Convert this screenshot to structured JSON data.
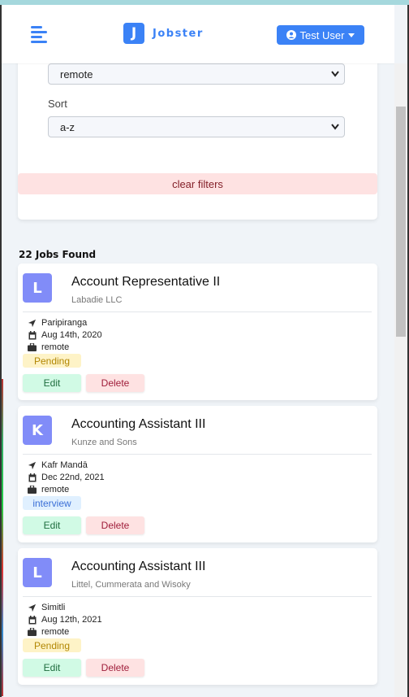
{
  "navbar": {
    "logo_letter": "J",
    "logo_text": "Jobster",
    "user_button_label": "Test User"
  },
  "filters": {
    "job_type_value": "remote",
    "sort_label": "Sort",
    "sort_value": "a-z",
    "clear_label": "clear filters"
  },
  "results": {
    "count_label": "22 Jobs Found"
  },
  "jobs": [
    {
      "initial": "L",
      "title": "Account Representative II",
      "company": "Labadie LLC",
      "location": "Paripiranga",
      "date": "Aug 14th, 2020",
      "job_type": "remote",
      "status": "Pending",
      "edit_label": "Edit",
      "delete_label": "Delete"
    },
    {
      "initial": "K",
      "title": "Accounting Assistant III",
      "company": "Kunze and Sons",
      "location": "Kafr Mandā",
      "date": "Dec 22nd, 2021",
      "job_type": "remote",
      "status": "interview",
      "edit_label": "Edit",
      "delete_label": "Delete"
    },
    {
      "initial": "L",
      "title": "Accounting Assistant III",
      "company": "Littel, Cummerata and Wisoky",
      "location": "Simitli",
      "date": "Aug 12th, 2021",
      "job_type": "remote",
      "status": "Pending",
      "edit_label": "Edit",
      "delete_label": "Delete"
    }
  ],
  "colors": {
    "primary": "#3b82f6",
    "avatar": "#818cf8",
    "pending_bg": "#fef3c7",
    "interview_bg": "#e0f0ff",
    "edit_bg": "#d1fae5",
    "delete_bg": "#fee2e2"
  }
}
